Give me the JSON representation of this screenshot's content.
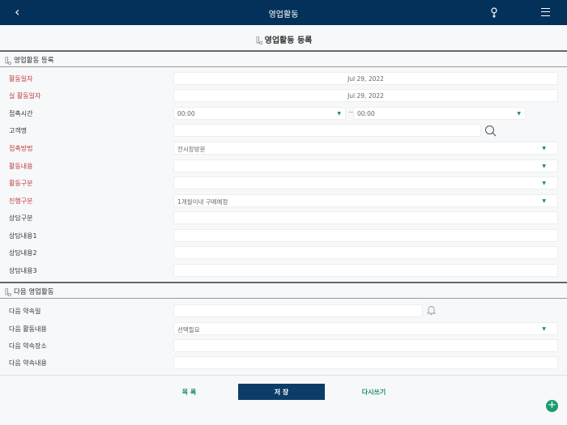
{
  "header": {
    "title": "영업활동",
    "back_icon": "chevron-left-icon",
    "pin_icon": "map-pin-icon",
    "menu_icon": "hamburger-menu-icon"
  },
  "page_title": "영업활동 등록",
  "section1": {
    "title": "영업활동 등록",
    "rows": [
      {
        "label": "활동일자",
        "required": true,
        "type": "date",
        "value": "Jul 29, 2022"
      },
      {
        "label": "실 활동일자",
        "required": true,
        "type": "date",
        "value": "Jul 29, 2022"
      },
      {
        "label": "접촉시간",
        "required": false,
        "type": "timerange",
        "value": "00:00",
        "value2": "00:00",
        "sep": "~"
      },
      {
        "label": "고객명",
        "required": false,
        "type": "search",
        "value": ""
      },
      {
        "label": "접촉방법",
        "required": true,
        "type": "select",
        "value": "전시장방문"
      },
      {
        "label": "활동내용",
        "required": true,
        "type": "select",
        "value": ""
      },
      {
        "label": "활동구분",
        "required": true,
        "type": "select",
        "value": ""
      },
      {
        "label": "진행구분",
        "required": true,
        "type": "select",
        "value": "1개월이내 구매예정"
      },
      {
        "label": "상담구분",
        "required": false,
        "type": "text",
        "value": ""
      },
      {
        "label": "상담내용1",
        "required": false,
        "type": "text",
        "value": ""
      },
      {
        "label": "상담내용2",
        "required": false,
        "type": "text",
        "value": ""
      },
      {
        "label": "상담내용3",
        "required": false,
        "type": "text",
        "value": ""
      }
    ]
  },
  "section2": {
    "title": "다음 영업활동",
    "rows": [
      {
        "label": "다음 약속일",
        "required": false,
        "type": "bell",
        "value": ""
      },
      {
        "label": "다음 활동내용",
        "required": false,
        "type": "select",
        "value": "선택필요"
      },
      {
        "label": "다음 약속장소",
        "required": false,
        "type": "text",
        "value": ""
      },
      {
        "label": "다음 약속내용",
        "required": false,
        "type": "text",
        "value": ""
      }
    ]
  },
  "footer": {
    "list_label": "목 록",
    "save_label": "저 장",
    "reset_label": "다시쓰기"
  },
  "colors": {
    "header": "#03315a",
    "required": "#c0393b",
    "accent": "#1e8c6a",
    "save": "#0b3d68"
  }
}
